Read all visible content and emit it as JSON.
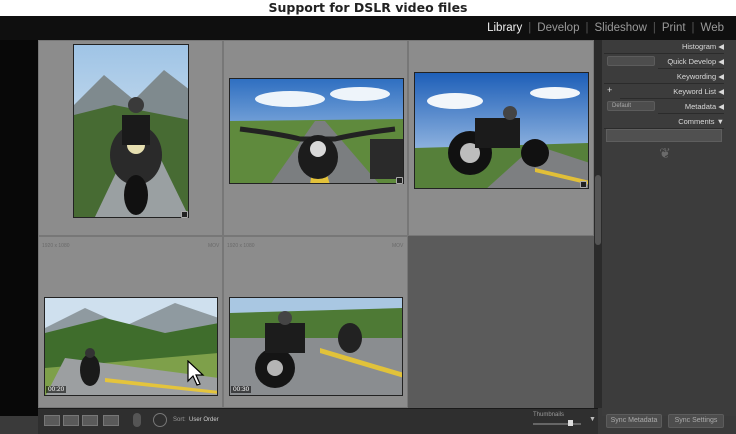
{
  "window": {
    "title": "Support for DSLR video files"
  },
  "modules": [
    {
      "label": "Library"
    },
    {
      "label": "Develop"
    },
    {
      "label": "Slideshow"
    },
    {
      "label": "Print"
    },
    {
      "label": "Web"
    }
  ],
  "panels": {
    "histogram": "Histogram",
    "quick_develop": "Quick Develop",
    "keywording": "Keywording",
    "keyword_list": "Keyword List",
    "metadata": "Metadata",
    "metadata_preset": "Default",
    "comments": "Comments",
    "plus": "+",
    "arrow_left": "◀",
    "arrow_down": "▼",
    "ornament": "❦"
  },
  "grid": {
    "cells": [
      {
        "dims": "1920 x 1080",
        "type": "MOV",
        "duration": "00:20"
      },
      {
        "dims": "1920 x 1080",
        "type": "MOV",
        "duration": "00:30"
      }
    ]
  },
  "toolbar": {
    "sort_label": "Sort:",
    "sort_value": "User Order",
    "thumbnails_label": "Thumbnails",
    "sync_metadata": "Sync Metadata",
    "sync_settings": "Sync Settings"
  },
  "colors": {
    "accent": "#f0f0f0",
    "cell_bg": "#8c8c8c",
    "panel_bg": "#3c3c3c",
    "toolbar_bg": "#2f2f2f"
  }
}
